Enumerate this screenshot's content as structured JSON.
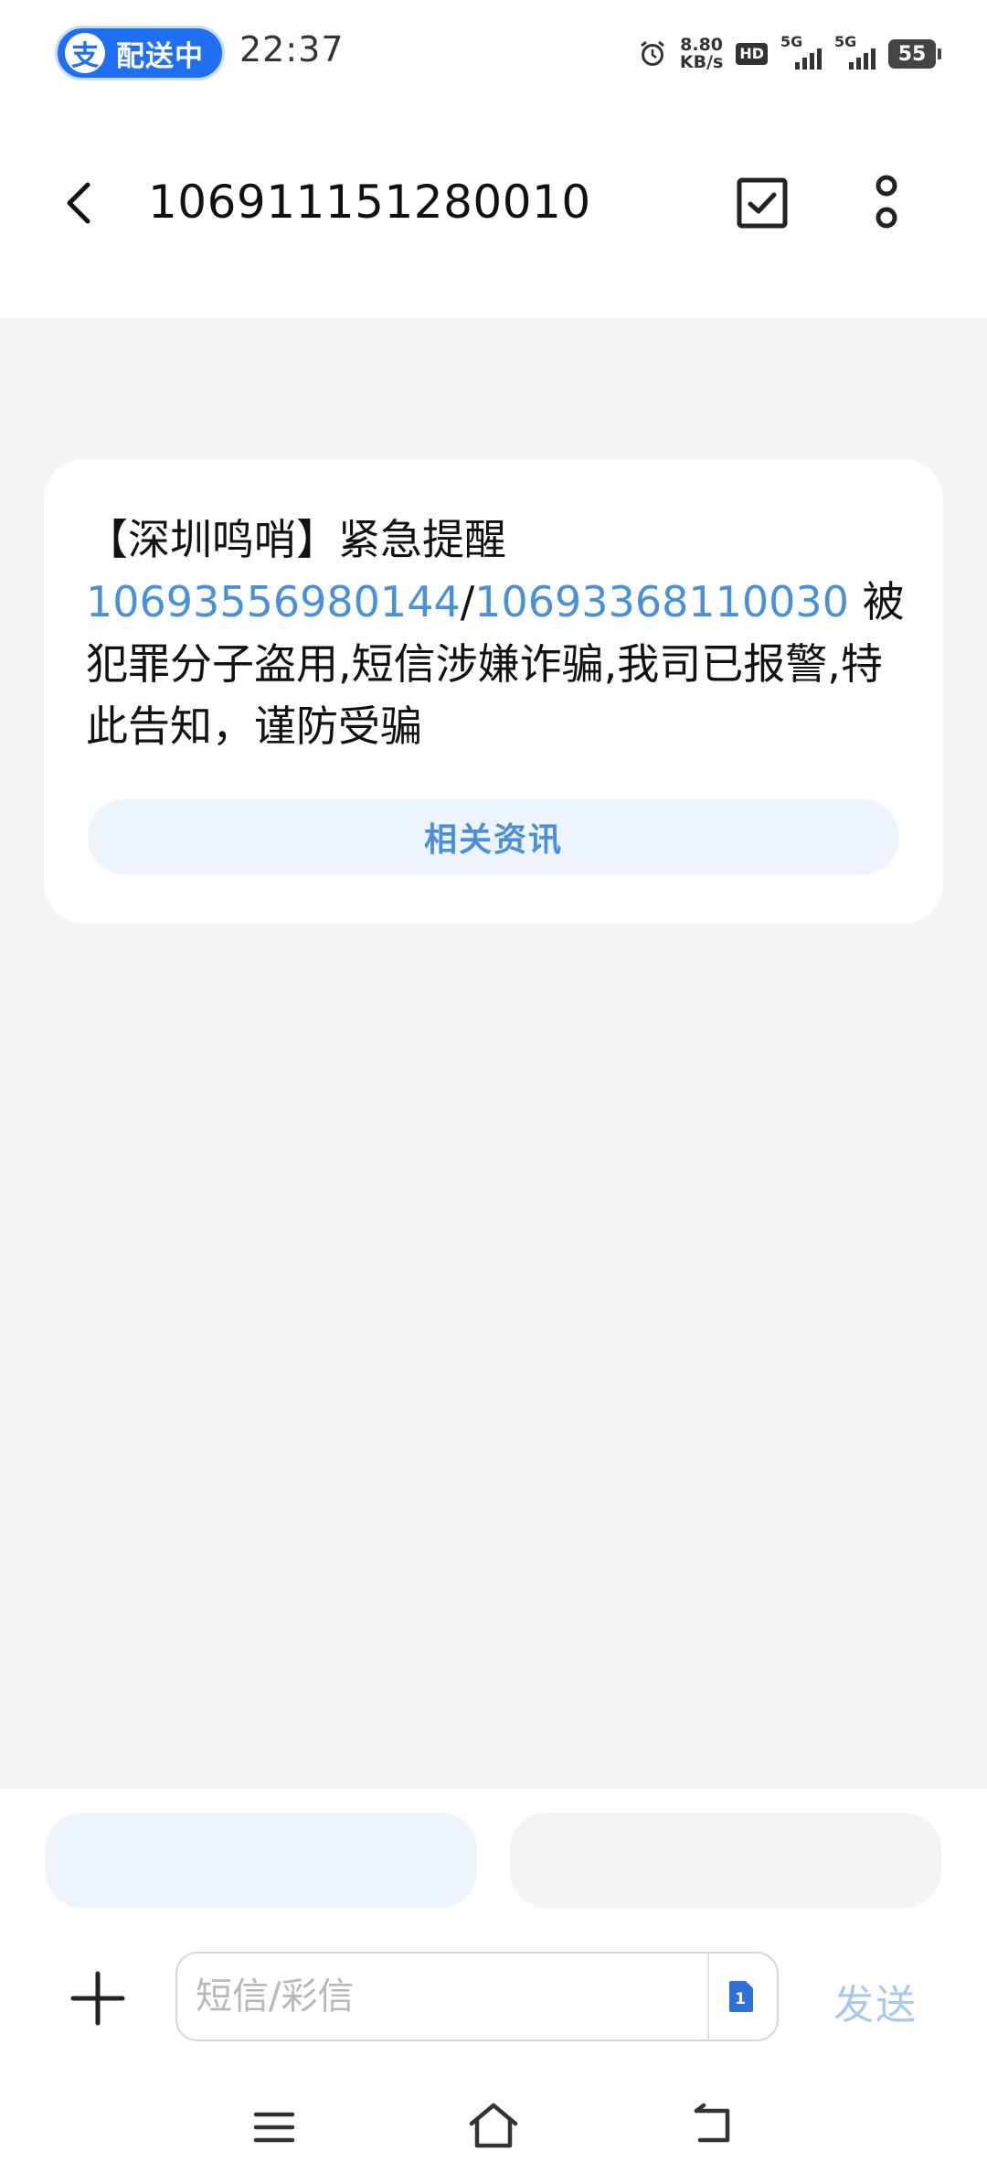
{
  "status_bar": {
    "pill_icon": "支",
    "pill_text": "配送中",
    "time": "22:37",
    "net_speed_value": "8.80",
    "net_speed_unit": "KB/s",
    "hd_label": "HD",
    "signal1_label": "5G",
    "signal2_label": "5G",
    "battery_level": "55"
  },
  "header": {
    "title": "106911151280010"
  },
  "message": {
    "prefix": "【深圳鸣哨】紧急提醒",
    "number1": "10693556980144",
    "separator": "/",
    "number2": "10693368110030",
    "body": "被犯罪分子盗用,短信涉嫌诈骗,我司已报警,特此告知，谨防受骗",
    "related_button": "相关资讯"
  },
  "composer": {
    "placeholder": "短信/彩信",
    "sim_label": "1",
    "send_label": "发送"
  },
  "colors": {
    "accent": "#4a90d9",
    "pill_blue": "#1f6ff2",
    "send_disabled": "#a9c8ef",
    "quick_reply_bg": "#edf4fe"
  }
}
